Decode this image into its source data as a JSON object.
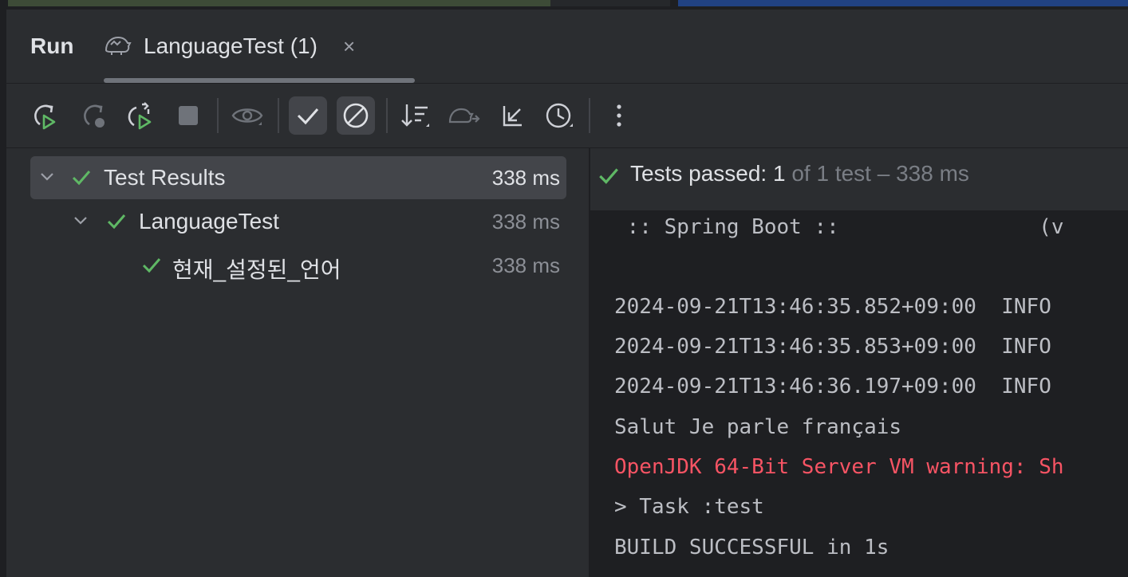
{
  "header": {
    "run_label": "Run",
    "tab": {
      "title": "LanguageTest (1)",
      "close": "×"
    }
  },
  "toolbar": {
    "buttons": [
      {
        "icon": "rerun-icon"
      },
      {
        "icon": "rerun-failed-icon"
      },
      {
        "icon": "toggle-auto-test-icon"
      },
      {
        "icon": "stop-icon"
      },
      {
        "icon": "eye-icon"
      },
      {
        "icon": "show-passed-icon",
        "active": true
      },
      {
        "icon": "show-ignored-icon",
        "active": true
      },
      {
        "icon": "sort-icon"
      },
      {
        "icon": "import-tests-icon"
      },
      {
        "icon": "collapse-icon"
      },
      {
        "icon": "history-icon"
      },
      {
        "icon": "more-vertical-icon"
      }
    ]
  },
  "tree": {
    "items": [
      {
        "label": "Test Results",
        "duration": "338 ms"
      },
      {
        "label": "LanguageTest",
        "duration": "338 ms"
      },
      {
        "label": "현재_설정된_언어",
        "duration": "338 ms"
      }
    ]
  },
  "status": {
    "passed_label": "Tests passed: 1",
    "rest": " of 1 test – 338 ms"
  },
  "console": {
    "lines": [
      " :: Spring Boot ::                (v",
      "",
      "2024-09-21T13:46:35.852+09:00  INFO",
      "2024-09-21T13:46:35.853+09:00  INFO",
      "2024-09-21T13:46:36.197+09:00  INFO",
      "Salut Je parle français",
      "OpenJDK 64-Bit Server VM warning: Sh",
      "> Task :test",
      "BUILD SUCCESSFUL in 1s"
    ]
  },
  "colors": {
    "success": "#5fb865",
    "error": "#f75464",
    "panel": "#2b2d30",
    "console_bg": "#1e1f22"
  }
}
